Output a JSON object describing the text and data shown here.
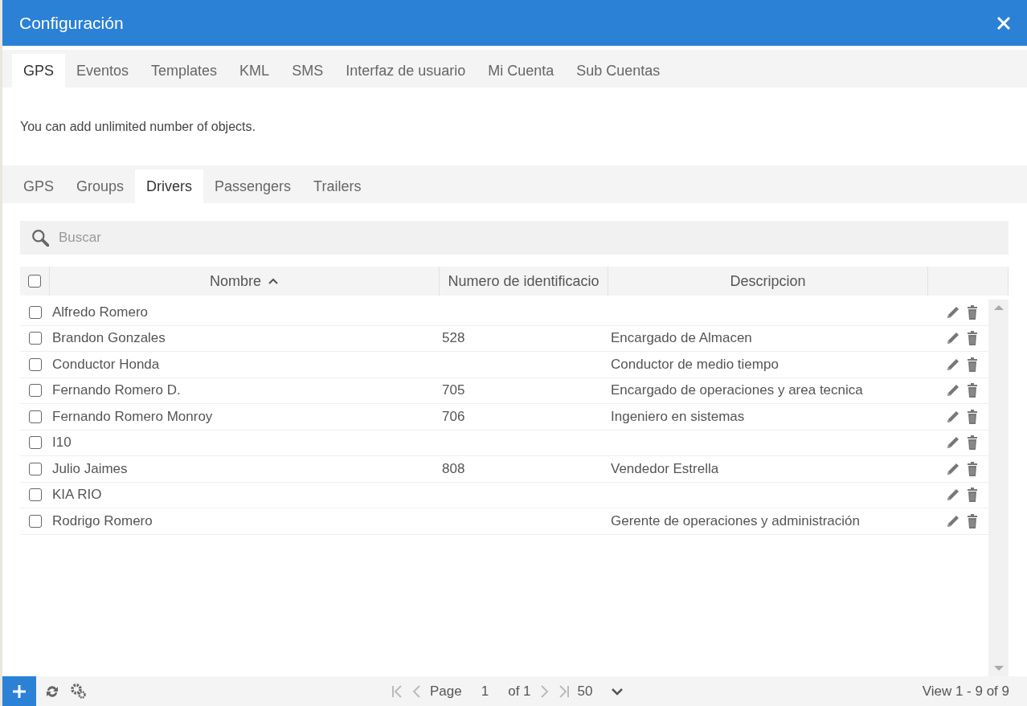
{
  "window": {
    "title": "Configuración"
  },
  "tabs": [
    {
      "label": "GPS",
      "selected": true
    },
    {
      "label": "Eventos",
      "selected": false
    },
    {
      "label": "Templates",
      "selected": false
    },
    {
      "label": "KML",
      "selected": false
    },
    {
      "label": "SMS",
      "selected": false
    },
    {
      "label": "Interfaz de usuario",
      "selected": false
    },
    {
      "label": "Mi Cuenta",
      "selected": false
    },
    {
      "label": "Sub Cuentas",
      "selected": false
    }
  ],
  "info": "You can add unlimited number of objects.",
  "sub_tabs": [
    {
      "label": "GPS",
      "selected": false
    },
    {
      "label": "Groups",
      "selected": false
    },
    {
      "label": "Drivers",
      "selected": true
    },
    {
      "label": "Passengers",
      "selected": false
    },
    {
      "label": "Trailers",
      "selected": false
    }
  ],
  "search": {
    "placeholder": "Buscar"
  },
  "table": {
    "select_all_checked": false,
    "columns": [
      {
        "label": "Nombre",
        "sorted": true
      },
      {
        "label": "Numero de identificacio",
        "sorted": false
      },
      {
        "label": "Descripcion",
        "sorted": false
      }
    ],
    "rows": [
      {
        "checked": false,
        "name": "Alfredo Romero",
        "id": "",
        "description": ""
      },
      {
        "checked": false,
        "name": "Brandon Gonzales",
        "id": "528",
        "description": "Encargado de Almacen"
      },
      {
        "checked": false,
        "name": "Conductor Honda",
        "id": "",
        "description": "Conductor de medio tiempo"
      },
      {
        "checked": false,
        "name": "Fernando Romero D.",
        "id": "705",
        "description": "Encargado de operaciones y area tecnica"
      },
      {
        "checked": false,
        "name": "Fernando Romero Monroy",
        "id": "706",
        "description": "Ingeniero en sistemas"
      },
      {
        "checked": false,
        "name": "I10",
        "id": "",
        "description": ""
      },
      {
        "checked": false,
        "name": "Julio Jaimes",
        "id": "808",
        "description": "Vendedor Estrella"
      },
      {
        "checked": false,
        "name": "KIA RIO",
        "id": "",
        "description": ""
      },
      {
        "checked": false,
        "name": "Rodrigo Romero",
        "id": "",
        "description": "Gerente de operaciones y administración"
      }
    ]
  },
  "pager": {
    "page_label": "Page",
    "page": "1",
    "of": "of 1",
    "page_size": "50",
    "view": "View 1 - 9 of 9"
  }
}
